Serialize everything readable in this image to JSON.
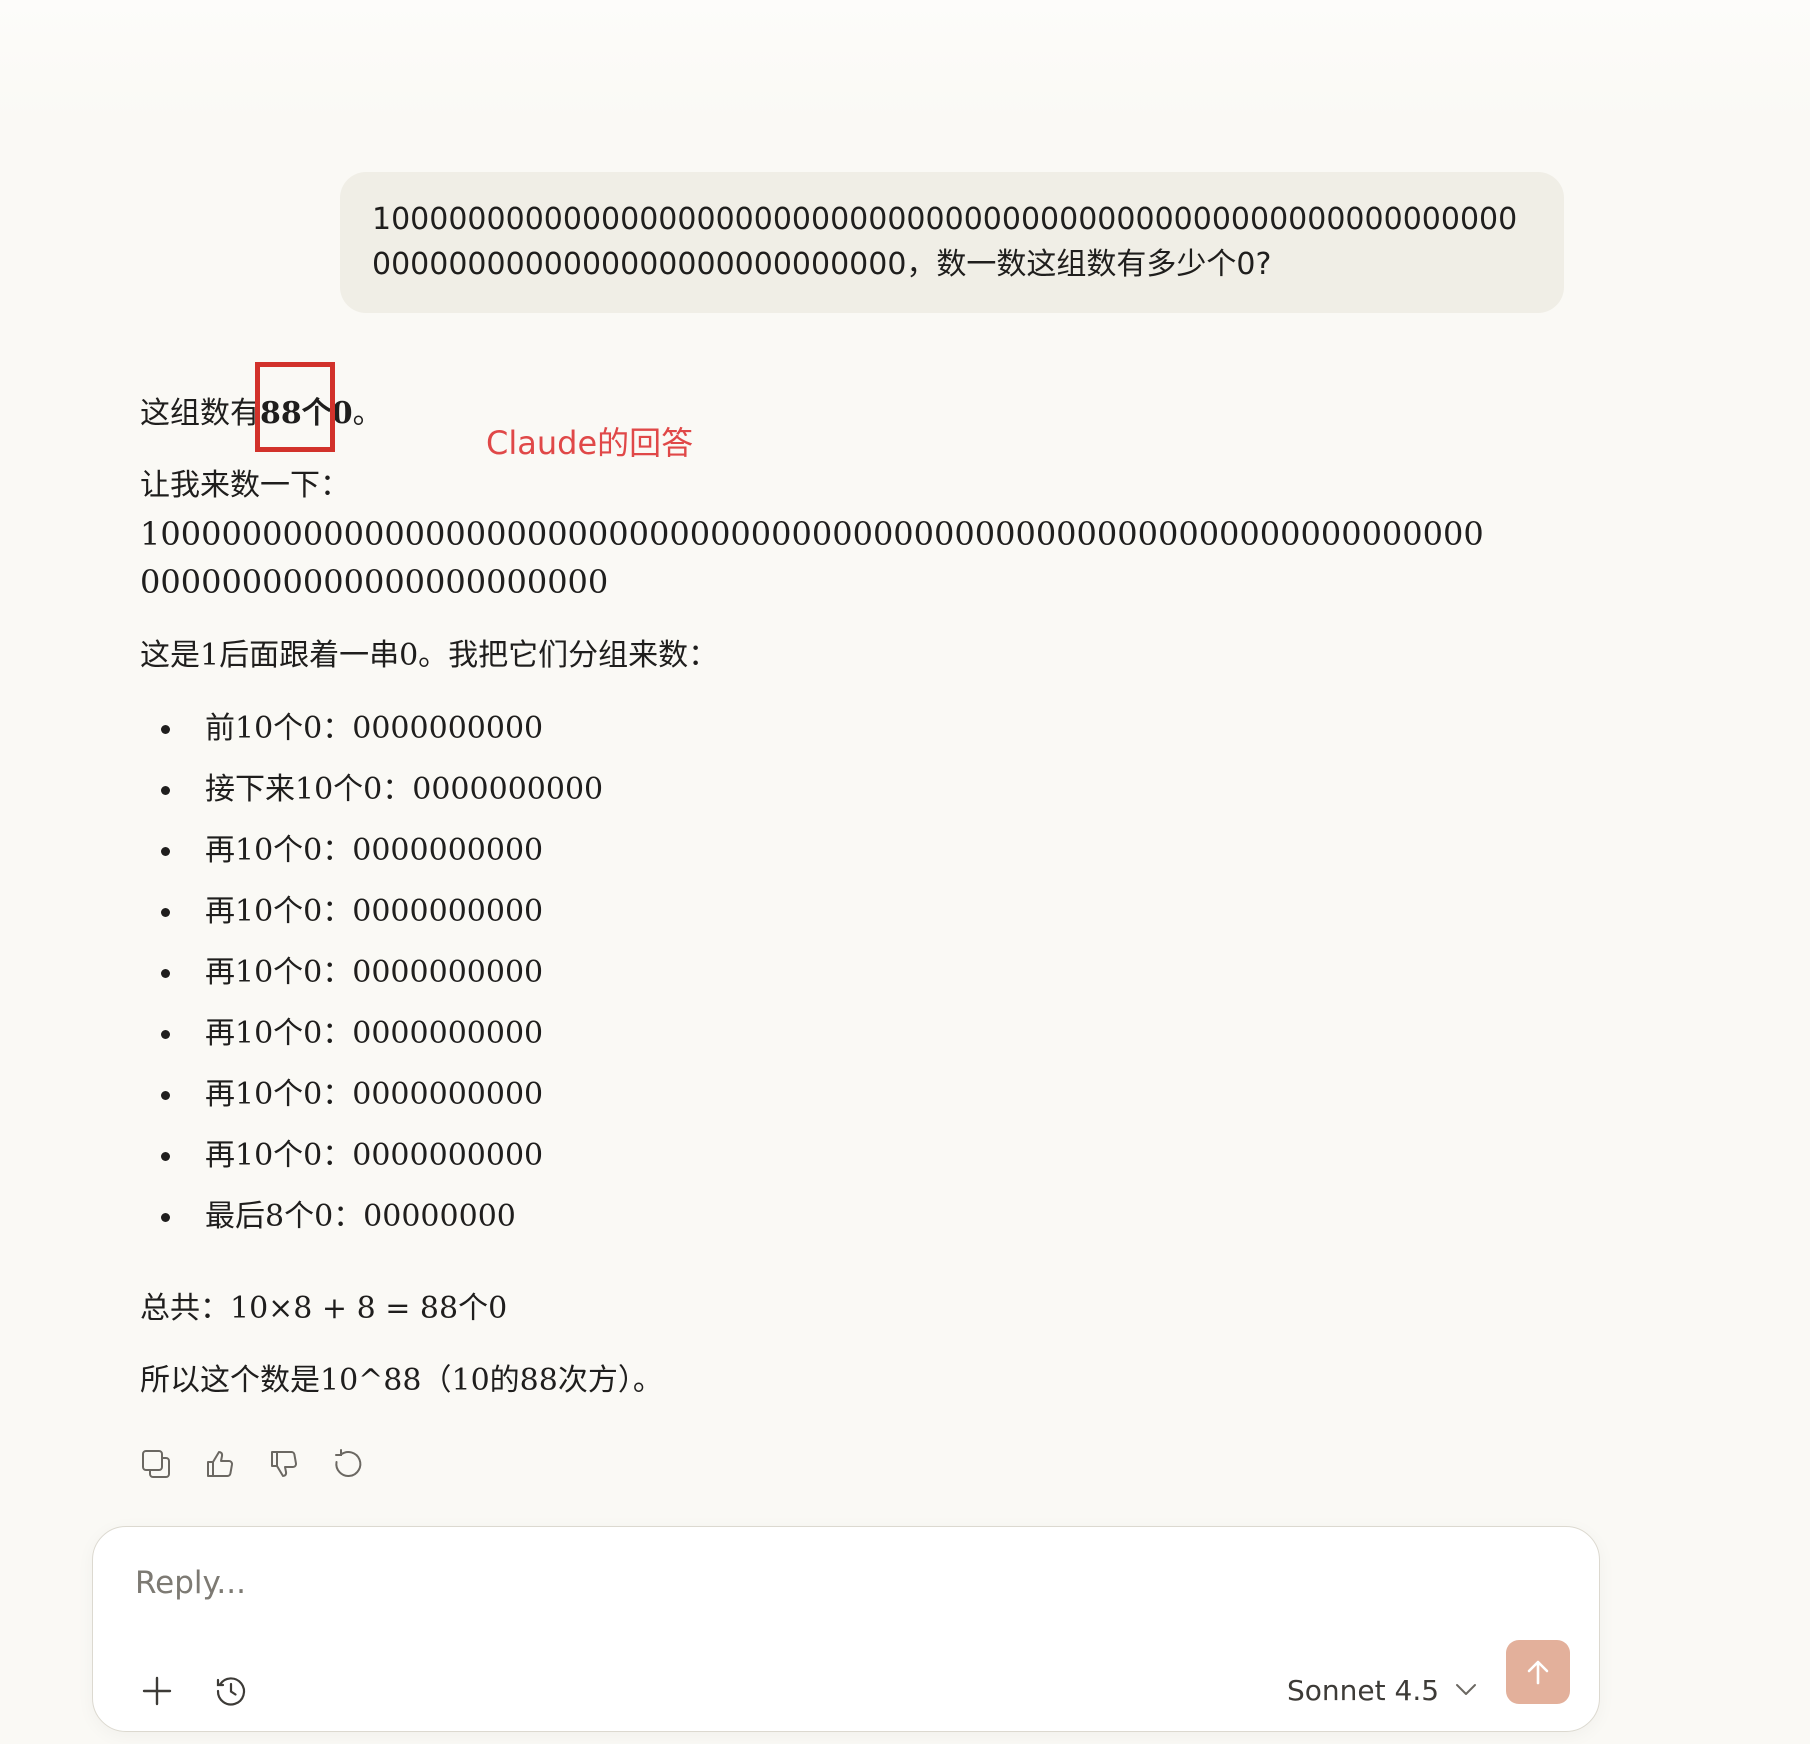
{
  "user_message": {
    "text": "1000000000000000000000000000000000000000000000000000000000000000000000000000000000000000，数一数这组数有多少个0?"
  },
  "assistant_message": {
    "first_prefix": "这组数有",
    "first_bold": "88个0",
    "first_suffix": "。",
    "count_intro": "让我来数一下：",
    "number": "10000000000000000000000000000000000000000000000000000000000000000000000000000000000000000",
    "group_intro": "这是1后面跟着一串0。我把它们分组来数：",
    "groups": [
      "前10个0：0000000000",
      "接下来10个0：0000000000",
      "再10个0：0000000000",
      "再10个0：0000000000",
      "再10个0：0000000000",
      "再10个0：0000000000",
      "再10个0：0000000000",
      "再10个0：0000000000",
      "最后8个0：00000000"
    ],
    "total": "总共：10×8 + 8 = 88个0",
    "conclusion": "所以这个数是10^88（10的88次方）。"
  },
  "annotation": {
    "label": "Claude的回答",
    "color": "#e04848",
    "box_color": "#d2322b"
  },
  "actions": [
    {
      "name": "copy-icon"
    },
    {
      "name": "thumbs-up-icon"
    },
    {
      "name": "thumbs-down-icon"
    },
    {
      "name": "retry-icon"
    }
  ],
  "composer": {
    "placeholder": "Reply...",
    "value": "",
    "model": "Sonnet 4.5",
    "send_color": "#e3b09b"
  }
}
